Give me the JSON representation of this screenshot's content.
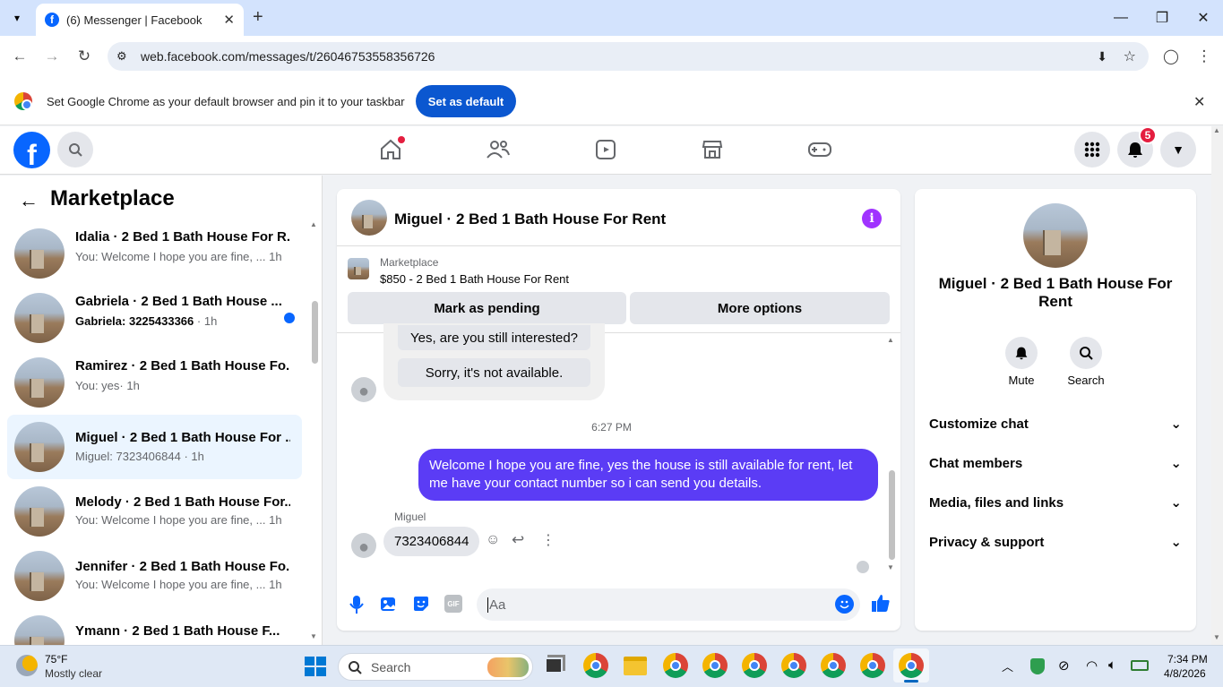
{
  "browser": {
    "tab_title": "(6) Messenger | Facebook",
    "url": "web.facebook.com/messages/t/26046753558356726"
  },
  "infobar": {
    "text": "Set Google Chrome as your default browser and pin it to your taskbar",
    "button": "Set as default"
  },
  "fb": {
    "notif_count": "5"
  },
  "left": {
    "title": "Marketplace",
    "conversations": [
      {
        "name": "Idalia · 2 Bed 1 Bath House For R...",
        "preview": "You: Welcome I hope you are fine, ...",
        "time": "1h"
      },
      {
        "name": "Gabriela · 2 Bed 1 Bath House ...",
        "preview": "Gabriela: 3225433366",
        "time": "· 1h"
      },
      {
        "name": "Ramirez · 2 Bed 1 Bath House Fo...",
        "preview": "You: yes",
        "time": "· 1h"
      },
      {
        "name": "Miguel · 2 Bed 1 Bath House For ...",
        "preview": "Miguel: 7323406844",
        "time": "· 1h"
      },
      {
        "name": "Melody · 2 Bed 1 Bath House For...",
        "preview": "You: Welcome I hope you are fine, ...",
        "time": "1h"
      },
      {
        "name": "Jennifer · 2 Bed 1 Bath House Fo...",
        "preview": "You: Welcome I hope you are fine, ...",
        "time": "1h"
      },
      {
        "name": "Ymann · 2 Bed 1 Bath House F...",
        "preview": "",
        "time": ""
      }
    ]
  },
  "chat": {
    "title": "Miguel · 2 Bed 1 Bath House For Rent",
    "listing_label": "Marketplace",
    "listing_title": "$850 - 2 Bed 1 Bath House For Rent",
    "mark_pending": "Mark as pending",
    "more_options": "More options",
    "quick_reply_1": "Yes, are you still interested?",
    "quick_reply_2": "Sorry, it's not available.",
    "timestamp": "6:27 PM",
    "sent_message": "Welcome I hope you are fine, yes the house is still available for rent, let me have your contact number so i can send you  details.",
    "sender_name": "Miguel",
    "received_message": "7323406844",
    "input_placeholder": "Aa"
  },
  "right": {
    "name": "Miguel · 2 Bed 1 Bath House For Rent",
    "mute": "Mute",
    "search": "Search",
    "sections": [
      "Customize chat",
      "Chat members",
      "Media, files and links",
      "Privacy & support"
    ]
  },
  "taskbar": {
    "temp": "75°F",
    "weather": "Mostly clear",
    "search": "Search",
    "time": "7:34 PM",
    "date": "4/8/2026"
  },
  "colors": {
    "accent": "#0866ff",
    "sent_bubble": "#5b3cf5",
    "info_purple": "#a033ff"
  }
}
